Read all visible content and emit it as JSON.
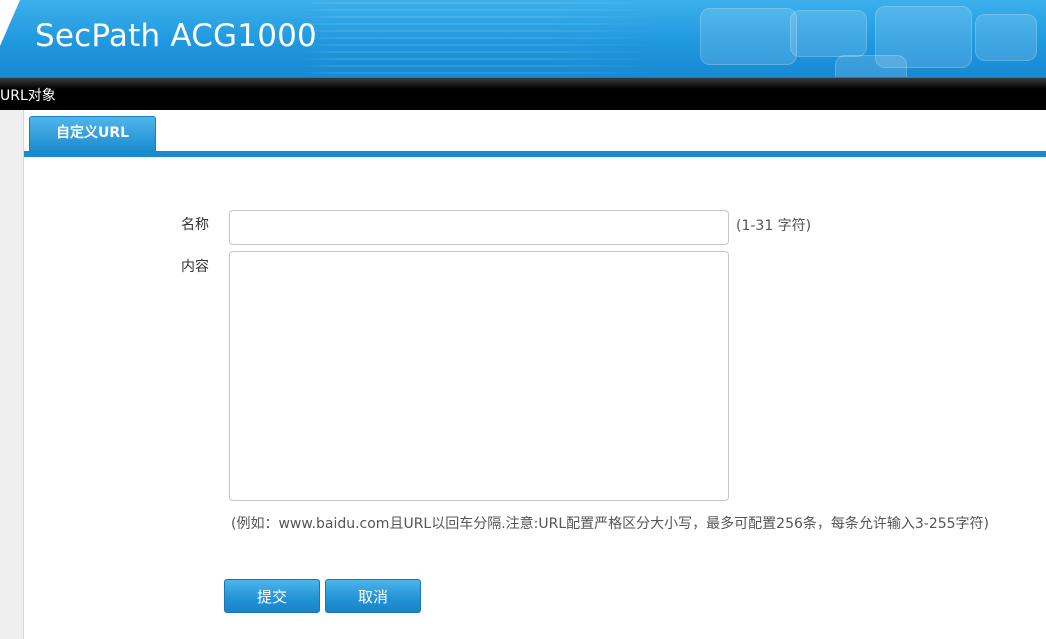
{
  "header": {
    "product_title": "SecPath ACG1000"
  },
  "titlebar": {
    "label": "URL对象"
  },
  "tabs": [
    {
      "label": "自定义URL",
      "active": true
    }
  ],
  "form": {
    "name": {
      "label": "名称",
      "value": "",
      "hint": "(1-31 字符)"
    },
    "content": {
      "label": "内容",
      "value": "",
      "hint": "(例如：www.baidu.com且URL以回车分隔.注意:URL配置严格区分大小写，最多可配置256条，每条允许输入3-255字符)"
    }
  },
  "buttons": {
    "submit_label": "提交",
    "cancel_label": "取消"
  },
  "colors": {
    "accent": "#1a8ad0",
    "banner": "#2aa3e6",
    "titlebar": "#000000"
  }
}
